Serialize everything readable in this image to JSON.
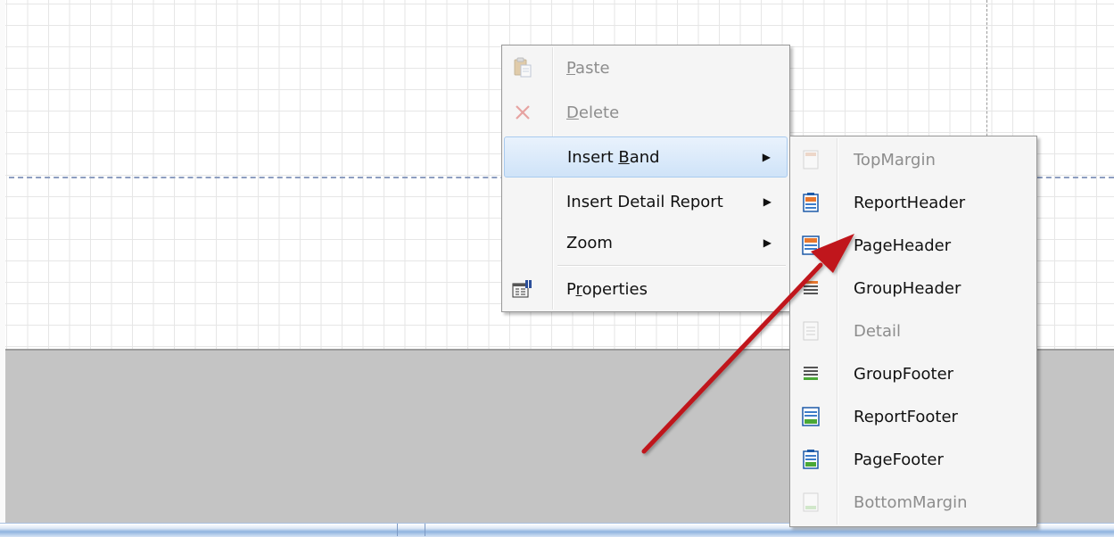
{
  "context_menu": {
    "items": [
      {
        "label": "Paste",
        "accel": "P",
        "rest": "aste",
        "icon": "paste-icon",
        "enabled": false
      },
      {
        "label": "Delete",
        "accel": "D",
        "rest": "elete",
        "icon": "delete-icon",
        "enabled": false
      },
      {
        "label": "Insert Band",
        "pre": "Insert ",
        "accel": "B",
        "rest": "and",
        "has_submenu": true,
        "highlighted": true
      },
      {
        "label": "Insert Detail Report",
        "has_submenu": true
      },
      {
        "label": "Zoom",
        "has_submenu": true
      },
      {
        "label": "Properties",
        "pre": "P",
        "accel": "r",
        "rest": "operties",
        "icon": "properties-icon"
      }
    ],
    "submenu_arrow": "▶"
  },
  "band_submenu": {
    "items": [
      {
        "label": "TopMargin",
        "icon": "top-margin-icon",
        "enabled": false
      },
      {
        "label": "ReportHeader",
        "icon": "report-header-icon",
        "enabled": true
      },
      {
        "label": "PageHeader",
        "icon": "page-header-icon",
        "enabled": true
      },
      {
        "label": "GroupHeader",
        "icon": "group-header-icon",
        "enabled": true
      },
      {
        "label": "Detail",
        "icon": "detail-icon",
        "enabled": false
      },
      {
        "label": "GroupFooter",
        "icon": "group-footer-icon",
        "enabled": true
      },
      {
        "label": "ReportFooter",
        "icon": "report-footer-icon",
        "enabled": true
      },
      {
        "label": "PageFooter",
        "icon": "page-footer-icon",
        "enabled": true
      },
      {
        "label": "BottomMargin",
        "icon": "bottom-margin-icon",
        "enabled": false
      }
    ]
  },
  "colors": {
    "highlight": "#cfe3f8",
    "annotation_arrow": "#c0161b",
    "band_blue": "#2f6fb8",
    "band_orange": "#e8772e",
    "band_green": "#4aa836"
  }
}
